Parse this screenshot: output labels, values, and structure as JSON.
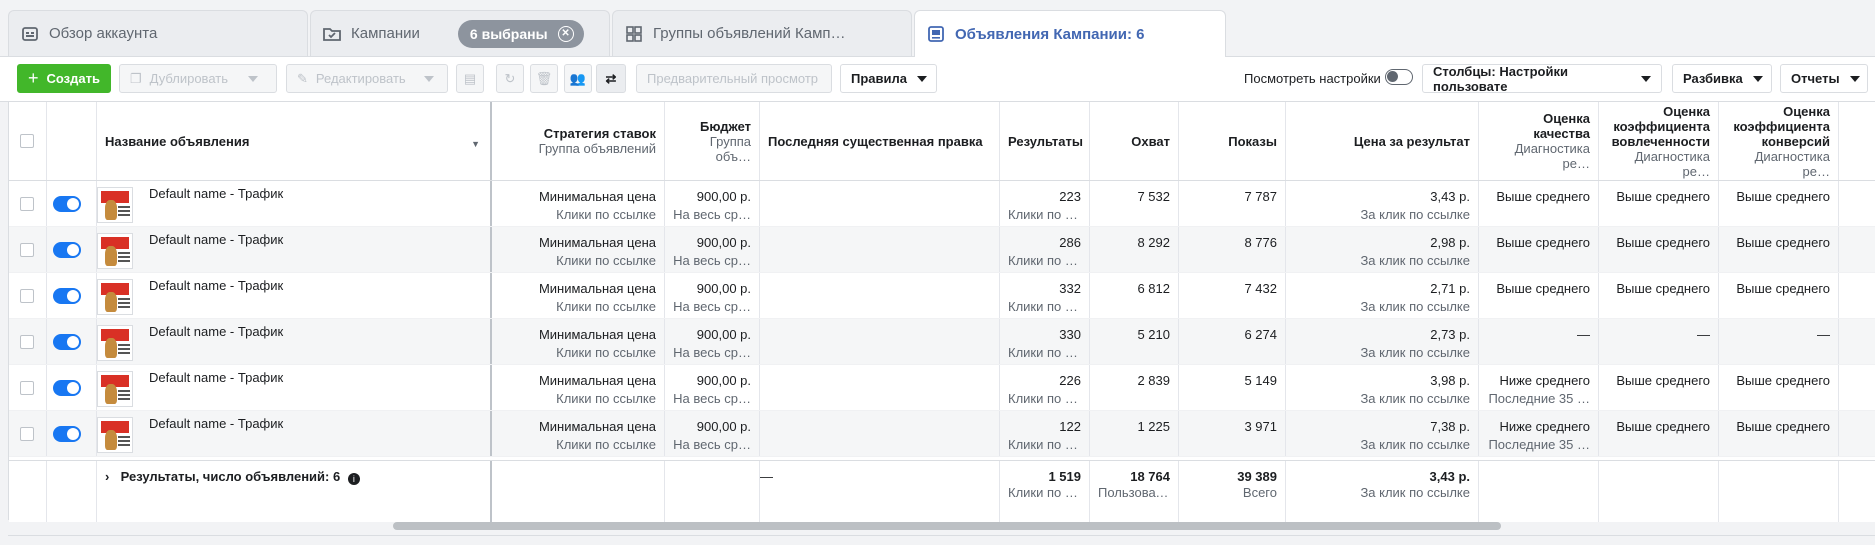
{
  "tabs": [
    {
      "label": "Обзор аккаунта",
      "icon": "dashboard-icon"
    },
    {
      "label": "Кампании",
      "icon": "folder-check-icon",
      "badge": "6 выбраны"
    },
    {
      "label": "Группы объявлений Камп…",
      "icon": "grid-icon"
    },
    {
      "label": "Объявления Кампании: 6",
      "icon": "ad-icon"
    }
  ],
  "toolbar": {
    "create": "Создать",
    "duplicate": "Дублировать",
    "edit": "Редактировать",
    "preview": "Предварительный просмотр",
    "rules": "Правила",
    "view_settings": "Посмотреть настройки",
    "columns": "Столбцы: Настройки пользовате",
    "breakdown": "Разбивка",
    "reports": "Отчеты"
  },
  "columns": {
    "name": "Название объявления",
    "strategy": "Стратегия ставок",
    "strategy_sub": "Группа объявлений",
    "budget": "Бюджет",
    "budget_sub": "Группа объ…",
    "last_edit": "Последняя существенная правка",
    "results": "Результаты",
    "reach": "Охват",
    "impressions": "Показы",
    "cost": "Цена за результат",
    "quality": "Оценка качества",
    "quality_sub": "Диагностика ре…",
    "engagement": "Оценка коэффициента вовлеченности",
    "engagement_sub": "Диагностика ре…",
    "conversion": "Оценка коэффициента конверсий",
    "conversion_sub": "Диагностика ре…"
  },
  "rows": [
    {
      "name": "Default name - Трафик",
      "strategy": "Минимальная цена",
      "strategy_sub": "Клики по ссылке",
      "budget": "900,00 р.",
      "budget_sub": "На весь ср…",
      "results": "223",
      "results_sub": "Клики по с…",
      "reach": "7 532",
      "impressions": "7 787",
      "cost": "3,43 р.",
      "cost_sub": "За клик по ссылке",
      "quality": "Выше среднего",
      "quality_sub": "",
      "engagement": "Выше среднего",
      "conversion": "Выше среднего"
    },
    {
      "name": "Default name - Трафик",
      "strategy": "Минимальная цена",
      "strategy_sub": "Клики по ссылке",
      "budget": "900,00 р.",
      "budget_sub": "На весь ср…",
      "results": "286",
      "results_sub": "Клики по с…",
      "reach": "8 292",
      "impressions": "8 776",
      "cost": "2,98 р.",
      "cost_sub": "За клик по ссылке",
      "quality": "Выше среднего",
      "quality_sub": "",
      "engagement": "Выше среднего",
      "conversion": "Выше среднего"
    },
    {
      "name": "Default name - Трафик",
      "strategy": "Минимальная цена",
      "strategy_sub": "Клики по ссылке",
      "budget": "900,00 р.",
      "budget_sub": "На весь ср…",
      "results": "332",
      "results_sub": "Клики по с…",
      "reach": "6 812",
      "impressions": "7 432",
      "cost": "2,71 р.",
      "cost_sub": "За клик по ссылке",
      "quality": "Выше среднего",
      "quality_sub": "",
      "engagement": "Выше среднего",
      "conversion": "Выше среднего"
    },
    {
      "name": "Default name - Трафик",
      "strategy": "Минимальная цена",
      "strategy_sub": "Клики по ссылке",
      "budget": "900,00 р.",
      "budget_sub": "На весь ср…",
      "results": "330",
      "results_sub": "Клики по с…",
      "reach": "5 210",
      "impressions": "6 274",
      "cost": "2,73 р.",
      "cost_sub": "За клик по ссылке",
      "quality": "—",
      "quality_sub": "",
      "engagement": "—",
      "conversion": "—"
    },
    {
      "name": "Default name - Трафик",
      "strategy": "Минимальная цена",
      "strategy_sub": "Клики по ссылке",
      "budget": "900,00 р.",
      "budget_sub": "На весь ср…",
      "results": "226",
      "results_sub": "Клики по с…",
      "reach": "2 839",
      "impressions": "5 149",
      "cost": "3,98 р.",
      "cost_sub": "За клик по ссылке",
      "quality": "Ниже среднего",
      "quality_sub": "Последние 35 …",
      "engagement": "Выше среднего",
      "conversion": "Выше среднего"
    },
    {
      "name": "Default name - Трафик",
      "strategy": "Минимальная цена",
      "strategy_sub": "Клики по ссылке",
      "budget": "900,00 р.",
      "budget_sub": "На весь ср…",
      "results": "122",
      "results_sub": "Клики по с…",
      "reach": "1 225",
      "impressions": "3 971",
      "cost": "7,38 р.",
      "cost_sub": "За клик по ссылке",
      "quality": "Ниже среднего",
      "quality_sub": "Последние 35 …",
      "engagement": "Выше среднего",
      "conversion": "Выше среднего"
    }
  ],
  "totals": {
    "label": "Результаты, число объявлений: 6",
    "last_edit": "—",
    "results": "1 519",
    "results_sub": "Клики по сс…",
    "reach": "18 764",
    "reach_sub": "Пользователи",
    "impressions": "39 389",
    "impressions_sub": "Всего",
    "cost": "3,43 р.",
    "cost_sub": "За клик по ссылке"
  }
}
